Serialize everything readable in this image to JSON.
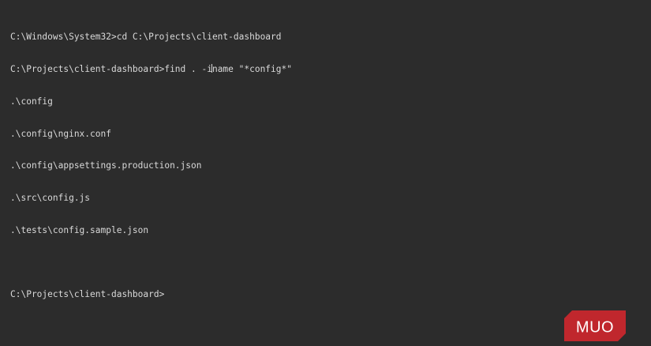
{
  "terminal": {
    "lines": [
      "C:\\Windows\\System32>cd C:\\Projects\\client-dashboard",
      "C:\\Projects\\client-dashboard>find . -iname \"*config*\"",
      ".\\config",
      ".\\config\\nginx.conf",
      ".\\config\\appsettings.production.json",
      ".\\src\\config.js",
      ".\\tests\\config.sample.json",
      "",
      "C:\\Projects\\client-dashboard>"
    ],
    "cmd2_before_cursor": "C:\\Projects\\client-dashboard>find . -i",
    "cmd2_after_cursor": "name \"*config*\""
  },
  "watermark": {
    "text": "MUO",
    "color": "#c0272d"
  }
}
